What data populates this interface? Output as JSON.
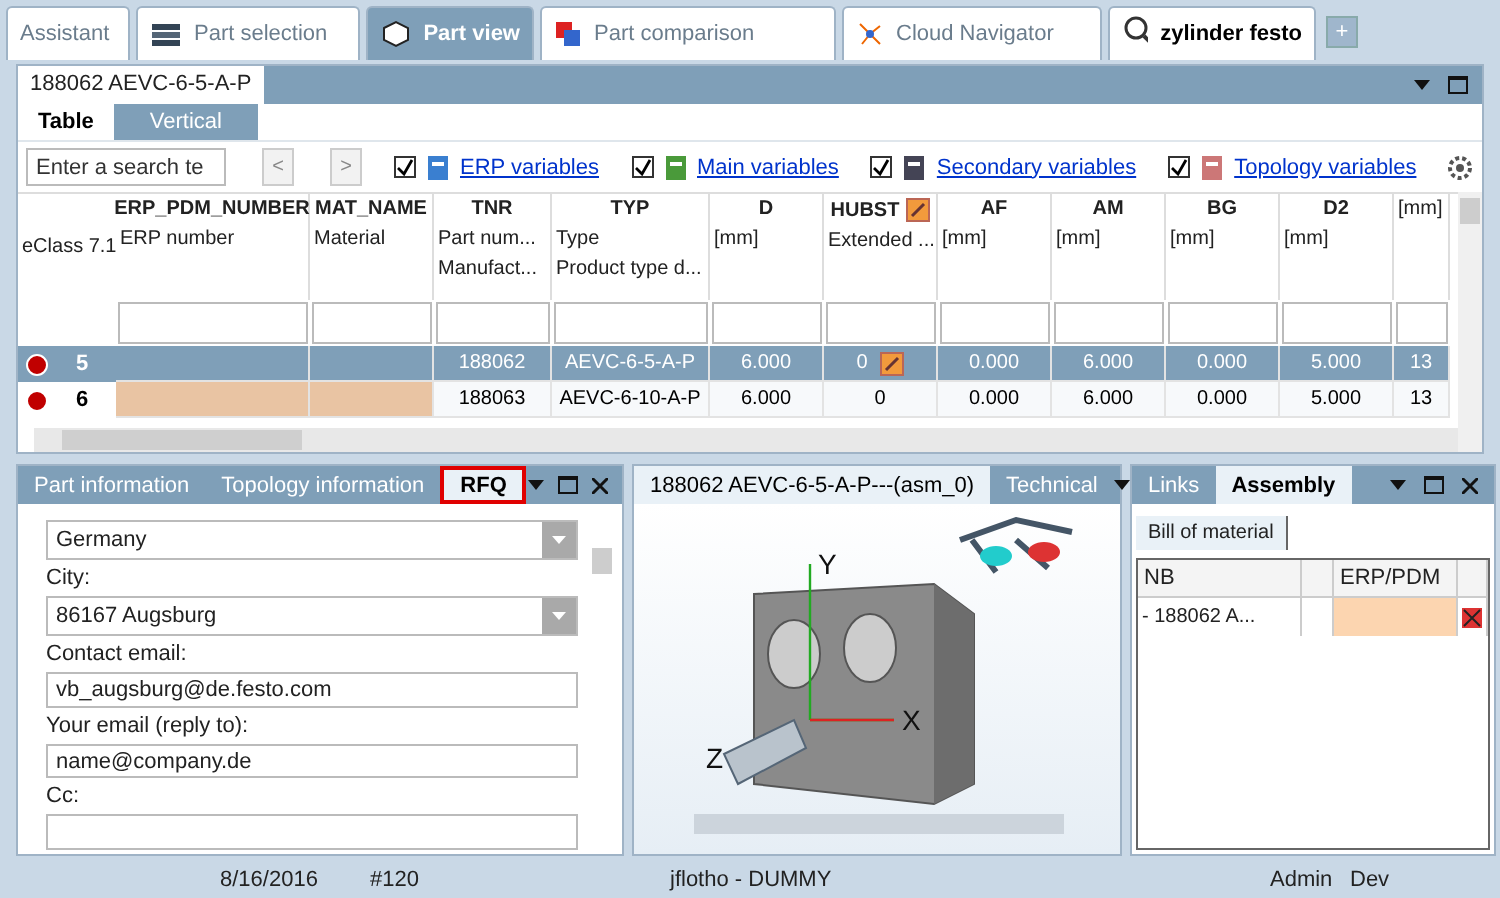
{
  "top_tabs": [
    {
      "label": "Assistant",
      "selected": false,
      "kind": "plain"
    },
    {
      "label": "Part selection",
      "selected": false,
      "kind": "stack"
    },
    {
      "label": "Part view",
      "selected": true,
      "kind": "cube"
    },
    {
      "label": "Part comparison",
      "selected": false,
      "kind": "compare"
    },
    {
      "label": "Cloud Navigator",
      "selected": false,
      "kind": "network"
    },
    {
      "label": "zylinder festo",
      "selected": false,
      "kind": "search"
    }
  ],
  "add_tab": "+",
  "part_panel": {
    "title": "188062 AEVC-6-5-A-P",
    "view_tabs": [
      {
        "label": "Table",
        "selected": true
      },
      {
        "label": "Vertical",
        "selected": false
      }
    ],
    "search": {
      "placeholder": "Enter a search te"
    },
    "nav": [
      "<",
      ">"
    ],
    "variable_filters": [
      {
        "label": "ERP variables",
        "checked": true,
        "kind": "erp"
      },
      {
        "label": "Main variables",
        "checked": true,
        "kind": "main"
      },
      {
        "label": "Secondary variables",
        "checked": true,
        "kind": "secondary"
      },
      {
        "label": "Topology variables",
        "checked": true,
        "kind": "topology"
      }
    ],
    "table": {
      "first_column": "eClass 7.1",
      "columns": [
        {
          "name": "ERP_PDM_NUMBER",
          "line1": "ERP number"
        },
        {
          "name": "MAT_NAME",
          "line1": "Material"
        },
        {
          "name": "TNR",
          "line1": "Part num...",
          "line2": "Manufact..."
        },
        {
          "name": "TYP",
          "line1": "Type",
          "line2": "Product type d..."
        },
        {
          "name": "D",
          "line1": "[mm]"
        },
        {
          "name": "HUBST",
          "line1": "Extended ...",
          "editable": true
        },
        {
          "name": "AF",
          "line1": "[mm]"
        },
        {
          "name": "AM",
          "line1": "[mm]"
        },
        {
          "name": "BG",
          "line1": "[mm]"
        },
        {
          "name": "D2",
          "line1": "[mm]"
        },
        {
          "line1": "[mm]"
        }
      ],
      "rows": [
        {
          "number": "5",
          "selected": true,
          "erp_missing": false,
          "color": "#c00000",
          "cells": [
            "",
            "",
            "188062",
            "AEVC-6-5-A-P",
            "6.000",
            "0",
            "0.000",
            "6.000",
            "0.000",
            "5.000",
            "13"
          ]
        },
        {
          "number": "6",
          "selected": false,
          "erp_missing": true,
          "color": "#c00000",
          "cells": [
            "",
            "",
            "188063",
            "AEVC-6-10-A-P",
            "6.000",
            "0",
            "0.000",
            "6.000",
            "0.000",
            "5.000",
            "13"
          ]
        }
      ]
    }
  },
  "info_panel": {
    "tabs": [
      {
        "label": "Part information",
        "selected": false
      },
      {
        "label": "Topology information",
        "selected": false
      },
      {
        "label": "RFQ",
        "selected": true
      }
    ],
    "fields": [
      {
        "value": "Germany",
        "kind": "select"
      },
      {
        "label": "City:",
        "value": "86167 Augsburg",
        "kind": "select"
      },
      {
        "label": "Contact email:",
        "value": "vb_augsburg@de.festo.com",
        "kind": "text"
      },
      {
        "label": "Your email (reply to):",
        "value": "name@company.de",
        "kind": "text"
      },
      {
        "label": "Cc:",
        "kind": "text"
      }
    ]
  },
  "view_panel": {
    "tabs": [
      {
        "label": "188062 AEVC-6-5-A-P---(asm_0)",
        "selected": true
      },
      {
        "label": "Technical",
        "selected": false
      }
    ],
    "axis_labels": [
      "Y",
      "X",
      "Z"
    ]
  },
  "assembly_panel": {
    "tabs": [
      {
        "label": "Links",
        "selected": false
      },
      {
        "label": "Assembly",
        "selected": true
      }
    ],
    "sub_tab": "Bill of material",
    "columns": [
      "NB",
      null,
      "ERP/PDM",
      null
    ],
    "rows": [
      {
        "name": "- 188062 A...",
        "erp_missing": true
      }
    ]
  },
  "status_bar": {
    "date": "8/16/2016",
    "number": "#120",
    "user": "jflotho - DUMMY",
    "role": "Admin",
    "mode": "Dev"
  }
}
